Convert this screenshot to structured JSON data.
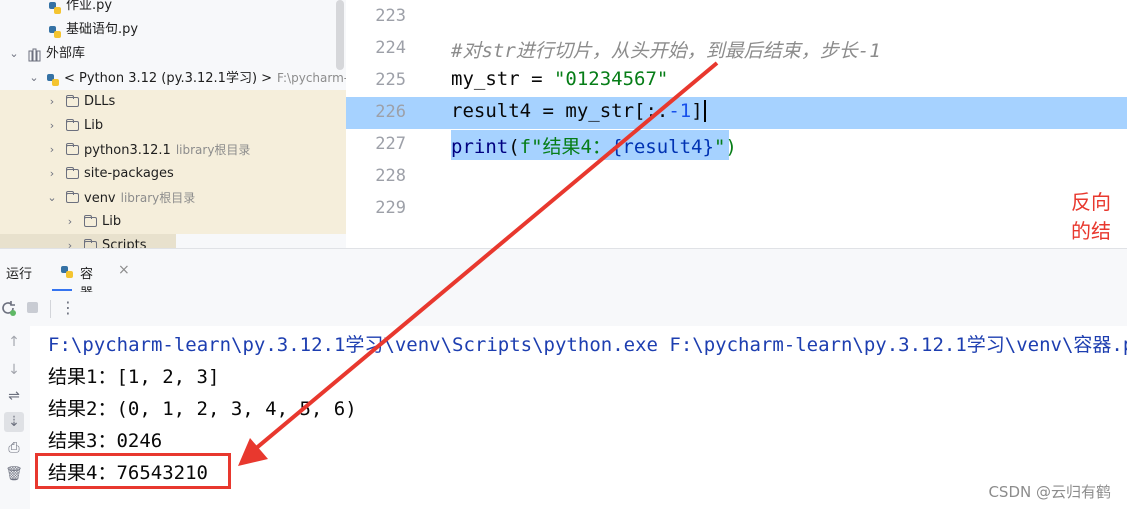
{
  "tree": {
    "rows": [
      {
        "label": "作业.py",
        "hint": "",
        "type": "pyfile"
      },
      {
        "label": "基础语句.py",
        "hint": "",
        "type": "pyfile"
      },
      {
        "label": "外部库",
        "hint": "",
        "type": "libs"
      },
      {
        "label": "< Python 3.12 (py.3.12.1学习) >",
        "hint": "F:\\pycharm-l",
        "type": "python"
      },
      {
        "label": "DLLs",
        "hint": "",
        "type": "folder"
      },
      {
        "label": "Lib",
        "hint": "",
        "type": "folder"
      },
      {
        "label": "python3.12.1",
        "hint": "library根目录",
        "type": "folder"
      },
      {
        "label": "site-packages",
        "hint": "",
        "type": "folder"
      },
      {
        "label": "venv",
        "hint": "library根目录",
        "type": "folder"
      },
      {
        "label": "Lib",
        "hint": "",
        "type": "folder"
      },
      {
        "label": "Scripts",
        "hint": "",
        "type": "folder"
      }
    ]
  },
  "editor": {
    "line_numbers": [
      "223",
      "224",
      "225",
      "226",
      "227",
      "228",
      "229"
    ],
    "comment": "#对str进行切片，从头开始，到最后结束，步长-1",
    "line225": {
      "var": "my_str",
      "eq": " = ",
      "str": "\"01234567\""
    },
    "line226": {
      "pre": "result4 = my_str[::",
      "num": "-1",
      "post": "]"
    },
    "line227": {
      "fn": "print",
      "open": "(",
      "fprefix": "f\"结果4：",
      "expr": "{result4}",
      "close": "\")"
    },
    "annotation": "反向的结果"
  },
  "run_panel": {
    "title": "运行",
    "tab": "容器",
    "close": "×",
    "console": [
      "F:\\pycharm-learn\\py.3.12.1学习\\venv\\Scripts\\python.exe F:\\pycharm-learn\\py.3.12.1学习\\venv\\容器.py",
      "结果1：[1, 2, 3]",
      "结果2：(0, 1, 2, 3, 4, 5, 6)",
      "结果3：0246",
      "结果4：76543210"
    ]
  },
  "watermark": "CSDN @云归有鹤",
  "colors": {
    "accent": "#3574f0",
    "annotation": "#e8382e",
    "selection": "#a6d2ff",
    "string": "#067d17"
  }
}
